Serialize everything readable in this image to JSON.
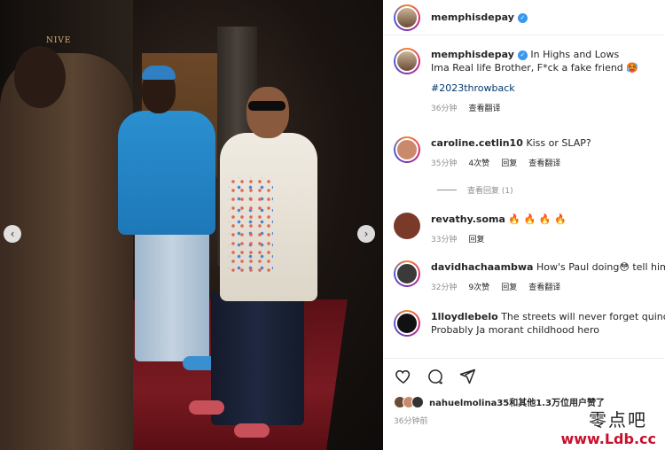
{
  "photo": {
    "sign_text": "NIVE",
    "prev_icon": "chevron-left-icon",
    "next_icon": "chevron-right-icon"
  },
  "header": {
    "username": "memphisdepay",
    "verified_icon": "verified-badge-icon"
  },
  "caption": {
    "username": "memphisdepay",
    "text_line1": "In Highs and Lows",
    "text_line2": "Ima Real life Brother, F*ck a fake friend 🥵",
    "hashtag": "#2023throwback",
    "time": "36分钟",
    "translate": "查看翻译"
  },
  "comments": [
    {
      "username": "caroline.cetlin10",
      "text": "Kiss or SLAP?",
      "time": "35分钟",
      "likes": "4次赞",
      "reply": "回复",
      "translate": "查看翻译",
      "avatar_color": "#c98a6b",
      "view_replies": "查看回复 (1)"
    },
    {
      "username": "revathy.soma",
      "text": "🔥 🔥 🔥 🔥",
      "time": "33分钟",
      "reply": "回复",
      "avatar_color": "#7a3a2a"
    },
    {
      "username": "davidhachaambwa",
      "text": "How's Paul doing😳  tell him w",
      "time": "32分钟",
      "likes": "9次赞",
      "reply": "回复",
      "translate": "查看翻译",
      "avatar_color": "#3a3a3a"
    },
    {
      "username": "1lloydlebelo",
      "text_line1": "The streets will never forget quincy p",
      "text_line2": "Probably Ja morant childhood hero",
      "avatar_color": "#111111"
    }
  ],
  "actions": {
    "like_icon": "heart-icon",
    "comment_icon": "comment-icon",
    "share_icon": "share-icon"
  },
  "likes": {
    "text": "nahuelmolina35和其他1.3万位用户赞了"
  },
  "date": "36分钟前",
  "watermark": {
    "line1": "零点吧",
    "line2": "www.Ldb.cc"
  },
  "colors": {
    "link": "#00376b",
    "muted": "#8e8e8e",
    "verified": "#3897f0"
  }
}
